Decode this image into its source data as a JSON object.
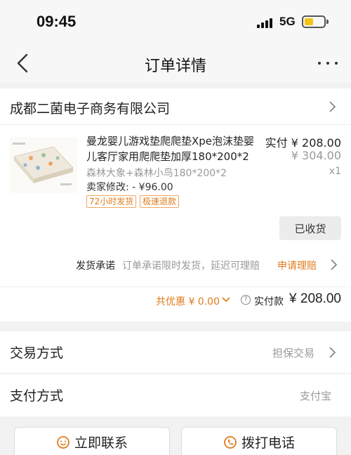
{
  "status_bar": {
    "time": "09:45",
    "network": "5G"
  },
  "nav": {
    "title": "订单详情",
    "more": "···"
  },
  "shop": {
    "name": "成都二菌电子商务有限公司"
  },
  "product": {
    "title": "曼龙婴儿游戏垫爬爬垫Xpe泡沫垫婴儿客厅家用爬爬垫加厚180*200*2",
    "spec": "森林大象+森林小鸟180*200*2",
    "seller_change": "卖家修改: - ¥96.00",
    "tags": [
      "72小时发货",
      "极速退款"
    ],
    "price_paid": "实付 ¥ 208.00",
    "price_original": "¥ 304.00",
    "quantity": "x1",
    "received_button": "已收货"
  },
  "promise": {
    "label": "发货承诺",
    "text": "订单承诺限时发货，延迟可理赔",
    "claim": "申请理赔"
  },
  "total": {
    "discount": "共优惠 ¥ 0.00",
    "help": "?",
    "paid_label": "实付款",
    "paid_amount": "¥ 208.00"
  },
  "rows": [
    {
      "label": "交易方式",
      "value": "担保交易"
    },
    {
      "label": "支付方式",
      "value": "支付宝"
    }
  ],
  "actions": {
    "contact": "立即联系",
    "call": "拨打电话"
  },
  "colors": {
    "accent": "#e07b1b",
    "battery": "#f3c318"
  }
}
